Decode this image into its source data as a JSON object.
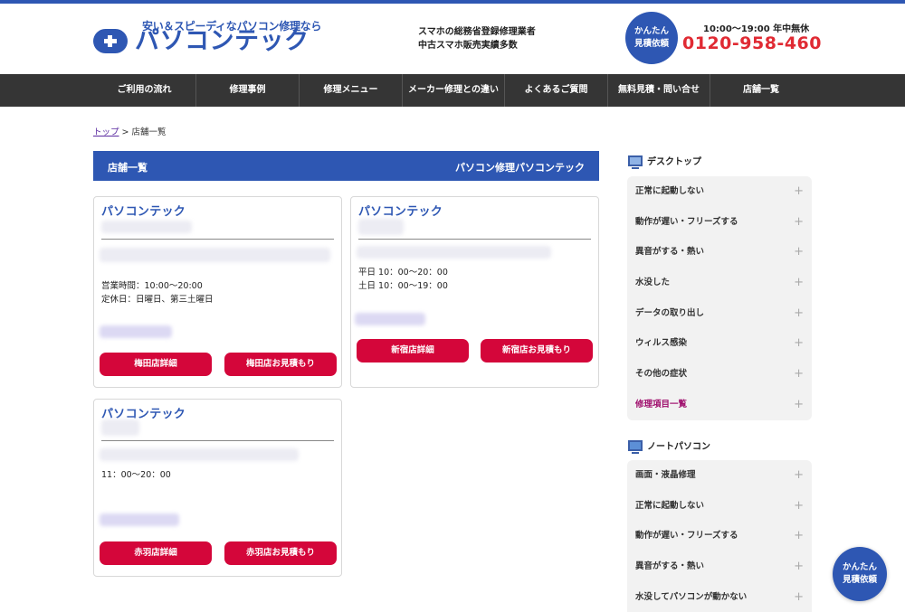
{
  "header": {
    "logo_tagline": "安い＆スピーディなパソコン修理なら",
    "logo_name": "パソコンテック",
    "tagline_line1": "スマホの総務省登録修理業者",
    "tagline_line2": "中古スマホ販売実績多数",
    "estimate_line1": "かんたん",
    "estimate_line2": "見積依頼",
    "hours": "10:00〜19:00 年中無休",
    "phone": "0120-958-460"
  },
  "nav": {
    "items": [
      {
        "label": "ご利用の流れ"
      },
      {
        "label": "修理事例"
      },
      {
        "label": "修理メニュー"
      },
      {
        "label": "メーカー修理との違い"
      },
      {
        "label": "よくあるご質問"
      },
      {
        "label": "無料見積・問い合せ"
      },
      {
        "label": "店舗一覧"
      }
    ]
  },
  "breadcrumb": {
    "home": "トップ",
    "separator": ">",
    "current": "店舗一覧"
  },
  "main": {
    "heading_left": "店舗一覧",
    "heading_right": "パソコン修理パソコンテック",
    "stores": [
      {
        "name": "パソコンテック",
        "info": "営業時間：10:00〜20:00\n定休日：日曜日、第三土曜日",
        "detail_label": "梅田店詳細",
        "estimate_label": "梅田店お見積もり"
      },
      {
        "name": "パソコンテック",
        "info": "平日 10：00〜20：00\n土日 10：00〜19：00",
        "detail_label": "新宿店詳細",
        "estimate_label": "新宿店お見積もり"
      },
      {
        "name": "パソコンテック",
        "info": "11：00〜20：00",
        "detail_label": "赤羽店詳細",
        "estimate_label": "赤羽店お見積もり"
      }
    ]
  },
  "sidebar": {
    "desktop": {
      "title": "デスクトップ",
      "icon": "desktop-pc-icon",
      "items": [
        {
          "label": "正常に起動しない"
        },
        {
          "label": "動作が遅い・フリーズする"
        },
        {
          "label": "異音がする・熱い"
        },
        {
          "label": "水没した"
        },
        {
          "label": "データの取り出し"
        },
        {
          "label": "ウィルス感染"
        },
        {
          "label": "その他の症状"
        },
        {
          "label": "修理項目一覧"
        }
      ]
    },
    "notebook": {
      "title": "ノートパソコン",
      "icon": "laptop-icon",
      "items": [
        {
          "label": "画面・液晶修理"
        },
        {
          "label": "正常に起動しない"
        },
        {
          "label": "動作が遅い・フリーズする"
        },
        {
          "label": "異音がする・熱い"
        },
        {
          "label": "水没してパソコンが動かない"
        }
      ]
    },
    "expand_symbol": "+"
  },
  "floating_button": {
    "line1": "かんたん",
    "line2": "見積依頼"
  },
  "colors": {
    "brand_blue": "#2e57b3",
    "nav_bg": "#353535",
    "button_red": "#d4063a",
    "phone_red": "#e02a33",
    "accent_magenta": "#a0106e"
  }
}
